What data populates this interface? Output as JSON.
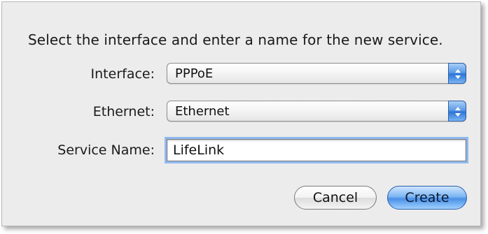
{
  "dialog": {
    "prompt": "Select the interface and enter a name for the new service.",
    "interface": {
      "label": "Interface:",
      "value": "PPPoE"
    },
    "ethernet": {
      "label": "Ethernet:",
      "value": "Ethernet"
    },
    "service_name": {
      "label": "Service Name:",
      "value": "LifeLink"
    },
    "buttons": {
      "cancel": "Cancel",
      "create": "Create"
    }
  },
  "colors": {
    "sheet_background": "#ececec",
    "accent_blue": "#4a90e6",
    "focus_ring": "#8fbaf0"
  },
  "icons": {
    "popup_arrows": "up-down-chevron-icon"
  }
}
